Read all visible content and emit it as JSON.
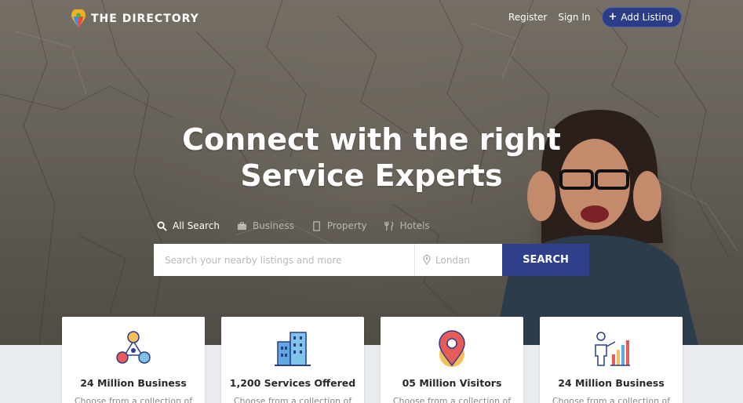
{
  "brand": {
    "name": "THE DIRECTORY"
  },
  "nav": {
    "register": "Register",
    "sign_in": "Sign In",
    "add_listing": "Add Listing"
  },
  "hero": {
    "headline_line1": "Connect with the right",
    "headline_line2": "Service Experts"
  },
  "search": {
    "tabs": [
      {
        "label": "All Search",
        "icon": "search-icon",
        "active": true
      },
      {
        "label": "Business",
        "icon": "briefcase-icon",
        "active": false
      },
      {
        "label": "Property",
        "icon": "building-icon",
        "active": false
      },
      {
        "label": "Hotels",
        "icon": "cutlery-icon",
        "active": false
      }
    ],
    "query_placeholder": "Search your nearby listings and more",
    "location_placeholder": "Londan",
    "button_label": "SEARCH"
  },
  "stats": [
    {
      "title": "24 Million Business",
      "desc": "Choose from a collection of",
      "icon": "network-people-icon"
    },
    {
      "title": "1,200 Services Offered",
      "desc": "Choose from a collection of",
      "icon": "buildings-icon"
    },
    {
      "title": "05 Million Visitors",
      "desc": "Choose from a collection of",
      "icon": "map-pin-icon"
    },
    {
      "title": "24 Million Business",
      "desc": "Choose from a collection of",
      "icon": "presenter-chart-icon"
    }
  ],
  "colors": {
    "accent": "#2f3f8c",
    "add_listing_bg": "#2b3d86"
  }
}
